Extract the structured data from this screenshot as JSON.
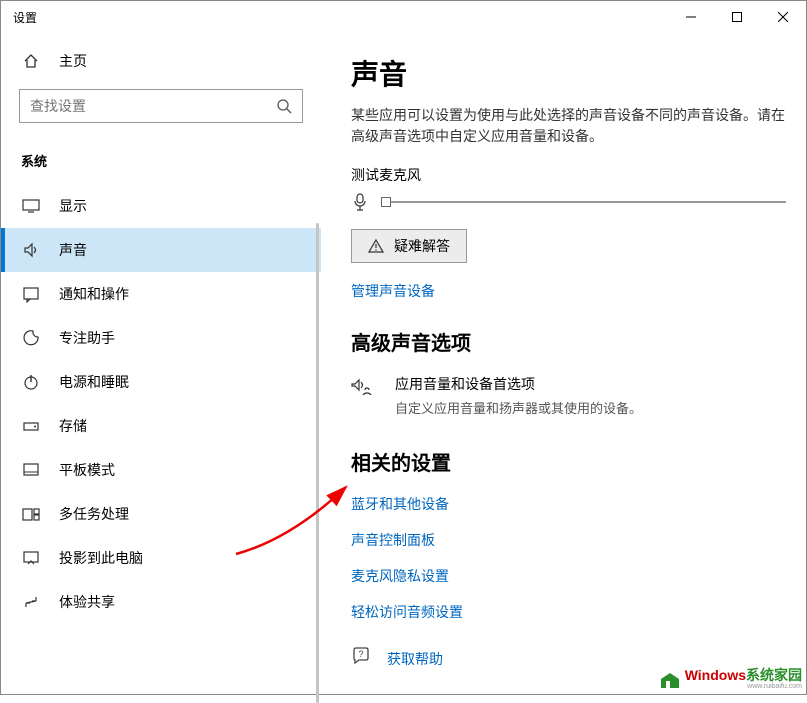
{
  "window": {
    "title": "设置"
  },
  "sidebar": {
    "home": "主页",
    "search_placeholder": "查找设置",
    "group": "系统",
    "items": [
      {
        "label": "显示"
      },
      {
        "label": "声音"
      },
      {
        "label": "通知和操作"
      },
      {
        "label": "专注助手"
      },
      {
        "label": "电源和睡眠"
      },
      {
        "label": "存储"
      },
      {
        "label": "平板模式"
      },
      {
        "label": "多任务处理"
      },
      {
        "label": "投影到此电脑"
      },
      {
        "label": "体验共享"
      }
    ]
  },
  "main": {
    "title": "声音",
    "description": "某些应用可以设置为使用与此处选择的声音设备不同的声音设备。请在高级声音选项中自定义应用音量和设备。",
    "test_mic_label": "测试麦克风",
    "troubleshoot": "疑难解答",
    "manage_devices": "管理声音设备",
    "advanced_heading": "高级声音选项",
    "app_prefs_title": "应用音量和设备首选项",
    "app_prefs_sub": "自定义应用音量和扬声器或其使用的设备。",
    "related_heading": "相关的设置",
    "related_links": [
      "蓝牙和其他设备",
      "声音控制面板",
      "麦克风隐私设置",
      "轻松访问音频设置"
    ],
    "get_help": "获取帮助"
  },
  "watermark": {
    "brand": "Windows",
    "suffix": "系统家园",
    "url": "www.ruibaifu.com"
  }
}
